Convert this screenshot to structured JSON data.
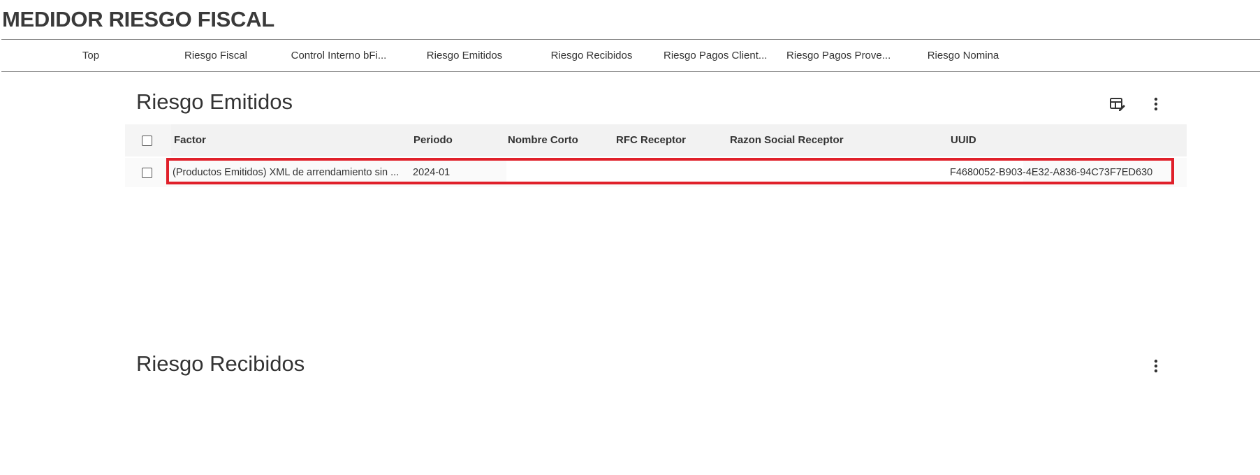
{
  "app": {
    "title": "MEDIDOR RIESGO FISCAL"
  },
  "nav": {
    "items": [
      {
        "label": "Top"
      },
      {
        "label": "Riesgo Fiscal"
      },
      {
        "label": "Control Interno bFi..."
      },
      {
        "label": "Riesgo Emitidos"
      },
      {
        "label": "Riesgo Recibidos"
      },
      {
        "label": "Riesgo Pagos Client..."
      },
      {
        "label": "Riesgo Pagos Prove..."
      },
      {
        "label": "Riesgo Nomina"
      }
    ]
  },
  "emitidos": {
    "title": "Riesgo Emitidos",
    "columns": [
      "Factor",
      "Periodo",
      "Nombre Corto",
      "RFC Receptor",
      "Razon Social Receptor",
      "UUID"
    ],
    "rows": [
      {
        "factor": "(Productos Emitidos) XML de arrendamiento sin ...",
        "periodo": "2024-01",
        "nombre_corto": "",
        "rfc_receptor": "",
        "razon_social": "",
        "uuid": "F4680052-B903-4E32-A836-94C73F7ED630"
      }
    ]
  },
  "recibidos": {
    "title": "Riesgo Recibidos"
  },
  "colors": {
    "highlight": "#e0202a",
    "header_bg": "#f5f5f5",
    "text": "#333333"
  },
  "icons": [
    "table-edit-icon",
    "more-vert-icon"
  ]
}
